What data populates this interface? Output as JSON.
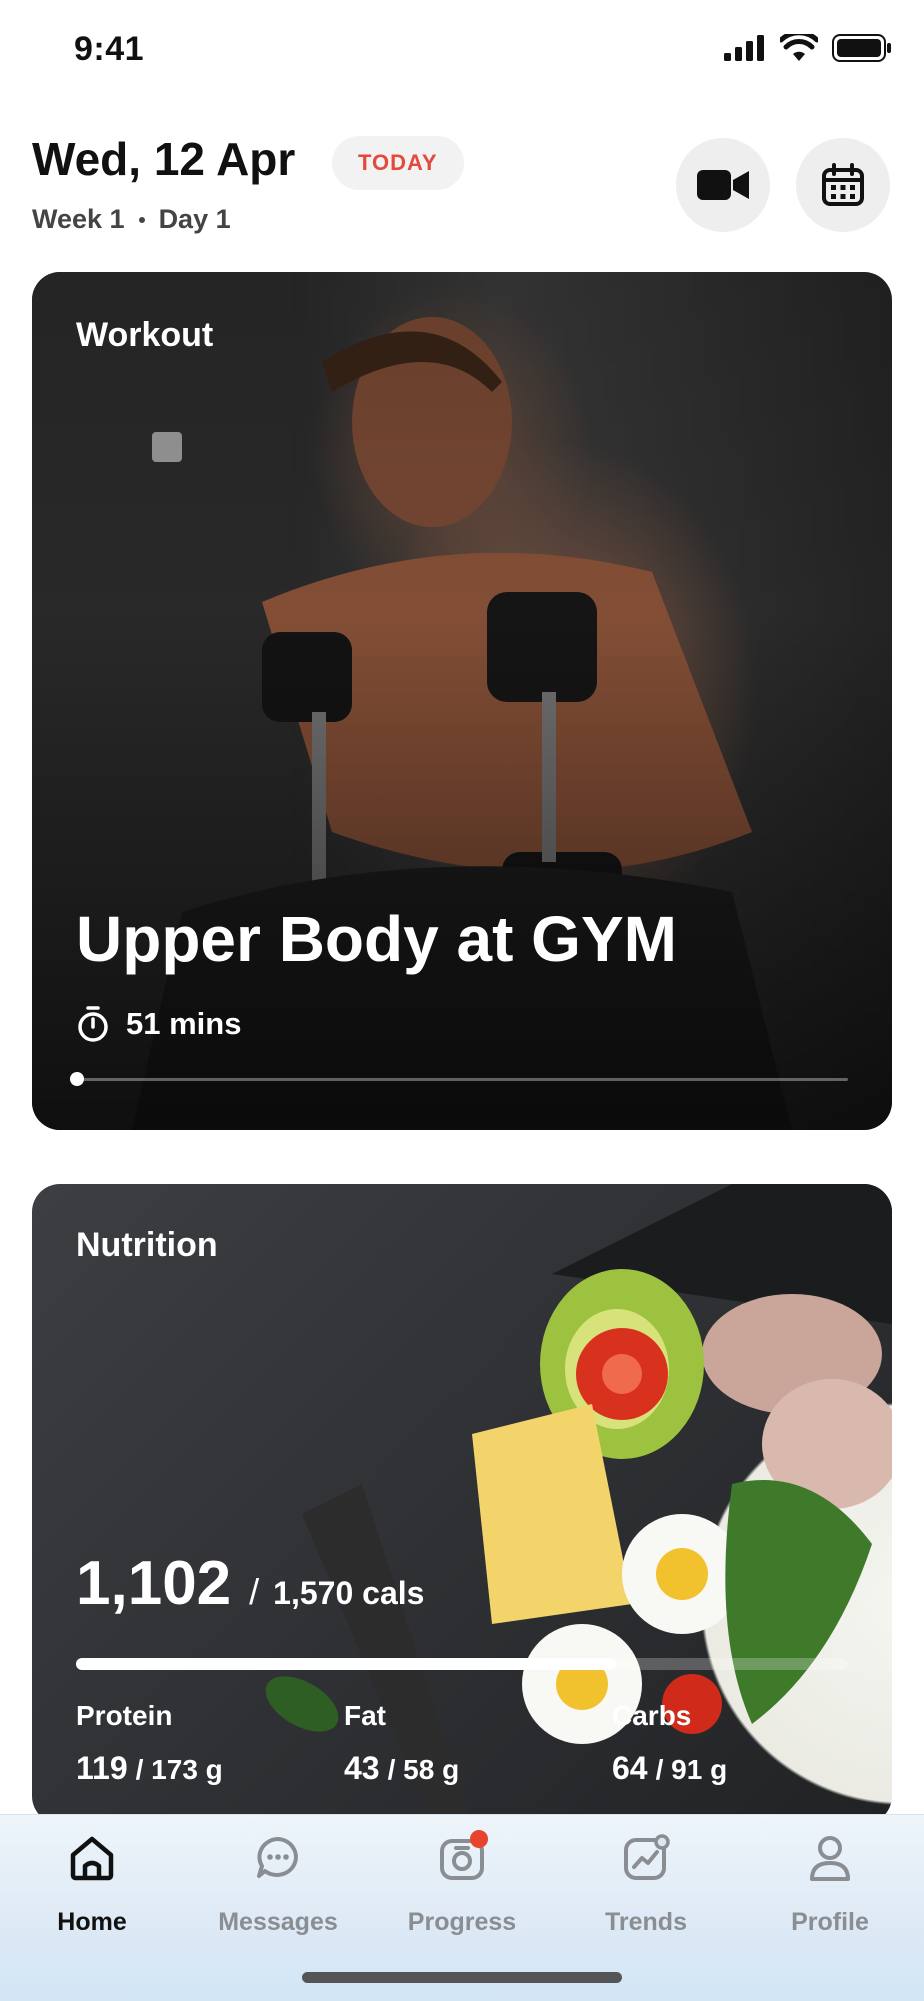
{
  "status_bar": {
    "time": "9:41"
  },
  "header": {
    "date": "Wed, 12 Apr",
    "today_badge": "TODAY",
    "week": "Week 1",
    "day": "Day 1"
  },
  "workout": {
    "section_label": "Workout",
    "title": "Upper Body at GYM",
    "duration": "51 mins",
    "progress_fraction": 0.0
  },
  "nutrition": {
    "section_label": "Nutrition",
    "calories_consumed": "1,102",
    "calories_goal": "1,570 cals",
    "calories_fraction": 0.7,
    "macros": [
      {
        "name": "Protein",
        "current": "119",
        "goal": "/ 173 g"
      },
      {
        "name": "Fat",
        "current": "43",
        "goal": "/ 58 g"
      },
      {
        "name": "Carbs",
        "current": "64",
        "goal": "/ 91 g"
      }
    ]
  },
  "tabs": [
    {
      "label": "Home",
      "icon": "home-icon",
      "active": true
    },
    {
      "label": "Messages",
      "icon": "chat-icon",
      "active": false
    },
    {
      "label": "Progress",
      "icon": "camera-icon",
      "active": false,
      "badge": true
    },
    {
      "label": "Trends",
      "icon": "trends-icon",
      "active": false
    },
    {
      "label": "Profile",
      "icon": "profile-icon",
      "active": false
    }
  ],
  "colors": {
    "accent": "#e34a3c",
    "badge": "#e8432f"
  }
}
